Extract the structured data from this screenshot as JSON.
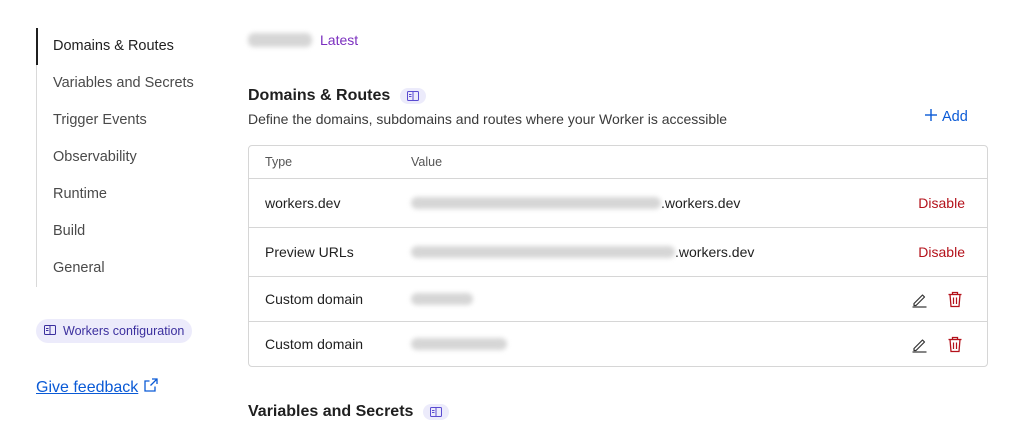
{
  "sidebar": {
    "items": [
      {
        "label": "Domains & Routes",
        "active": true
      },
      {
        "label": "Variables and Secrets"
      },
      {
        "label": "Trigger Events"
      },
      {
        "label": "Observability"
      },
      {
        "label": "Runtime"
      },
      {
        "label": "Build"
      },
      {
        "label": "General"
      }
    ],
    "workers_config_label": "Workers configuration",
    "feedback_label": "Give feedback"
  },
  "version": {
    "tag": "Latest"
  },
  "domains": {
    "title": "Domains & Routes",
    "description": "Define the domains, subdomains and routes where your Worker is accessible",
    "add_label": "Add",
    "columns": {
      "type": "Type",
      "value": "Value"
    },
    "rows": [
      {
        "type": "workers.dev",
        "value_suffix": ".workers.dev",
        "action": "Disable"
      },
      {
        "type": "Preview URLs",
        "value_suffix": ".workers.dev",
        "action": "Disable"
      },
      {
        "type": "Custom domain",
        "value_suffix": ""
      },
      {
        "type": "Custom domain",
        "value_suffix": ""
      }
    ]
  },
  "variables": {
    "title": "Variables and Secrets"
  },
  "colors": {
    "accent": "#0a5ad6",
    "danger": "#b4121b",
    "badge": "#ecebfb",
    "latest": "#7b2fbf"
  },
  "icons": [
    "book-icon",
    "plus-icon",
    "external-link-icon",
    "pencil-icon",
    "trash-icon"
  ]
}
